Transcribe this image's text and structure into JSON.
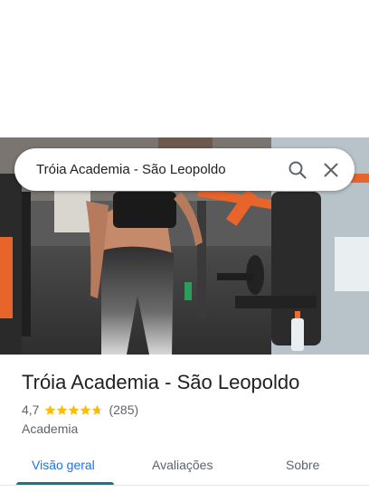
{
  "search": {
    "query": "Tróia Academia - São Leopoldo",
    "search_icon": "search-icon",
    "close_icon": "close-icon"
  },
  "hero_photo": {
    "subject": "gym-interior-photo",
    "accent_color": "#f26a2e"
  },
  "place": {
    "name": "Tróia Academia - São Leopoldo",
    "rating": "4,7",
    "rating_value": 4.7,
    "stars_max": 5,
    "review_count": "(285)",
    "category": "Academia",
    "star_color": "#fbbc04"
  },
  "tabs": [
    {
      "label": "Visão geral",
      "active": true
    },
    {
      "label": "Avaliações",
      "active": false
    },
    {
      "label": "Sobre",
      "active": false
    }
  ],
  "colors": {
    "active_tab_text": "#1a73e8",
    "active_tab_indicator": "#0b7d83"
  }
}
